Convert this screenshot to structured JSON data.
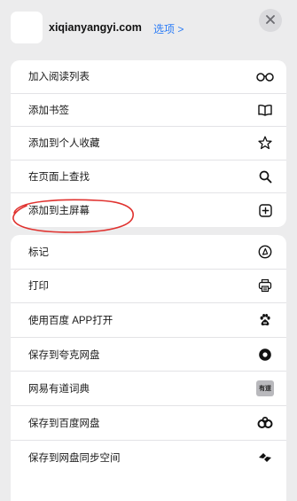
{
  "header": {
    "site_name": "xiqianyangyi.com",
    "options_label": "选项 >"
  },
  "group1": [
    {
      "label": "加入阅读列表",
      "icon": "reading-list-icon"
    },
    {
      "label": "添加书签",
      "icon": "book-icon"
    },
    {
      "label": "添加到个人收藏",
      "icon": "star-icon"
    },
    {
      "label": "在页面上查找",
      "icon": "search-icon"
    },
    {
      "label": "添加到主屏幕",
      "icon": "add-square-icon"
    }
  ],
  "group2": [
    {
      "label": "标记",
      "icon": "markup-icon"
    },
    {
      "label": "打印",
      "icon": "printer-icon"
    },
    {
      "label": "使用百度 APP打开",
      "icon": "baidu-paw-icon"
    },
    {
      "label": "保存到夸克网盘",
      "icon": "quark-icon"
    },
    {
      "label": "网易有道词典",
      "icon": "youdao-icon",
      "badge": "有道"
    },
    {
      "label": "保存到百度网盘",
      "icon": "baidu-netdisk-icon"
    },
    {
      "label": "保存到网盘同步空间",
      "icon": "sync-space-icon"
    }
  ],
  "colors": {
    "accent": "#2b7cf6",
    "annotation": "#e0322f",
    "background": "#ececed"
  }
}
